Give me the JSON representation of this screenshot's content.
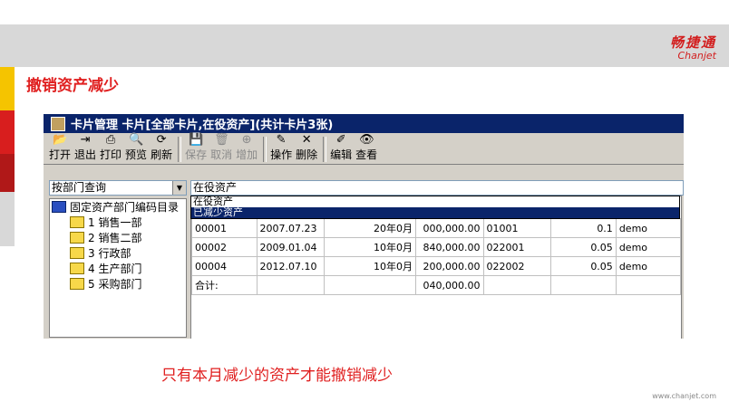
{
  "brand": {
    "logo_cn": "畅捷通",
    "logo_en": "Chanjet"
  },
  "slide": {
    "title": "撤销资产减少",
    "caption": "只有本月减少的资产才能撤销减少",
    "footer_url": "www.chanjet.com"
  },
  "colors": {
    "accent": "#e02020",
    "titlebar": "#0a246a",
    "strip_yellow": "#f5c400",
    "strip_red": "#d81e1e",
    "strip_dark": "#b01818"
  },
  "window": {
    "title": "卡片管理  卡片[全部卡片,在役资产](共计卡片3张)",
    "toolbar": [
      {
        "label": "打开",
        "icon": "open-folder-icon",
        "glyph": "📂",
        "disabled": false
      },
      {
        "label": "退出",
        "icon": "exit-icon",
        "glyph": "⇥",
        "disabled": false
      },
      {
        "label": "打印",
        "icon": "printer-icon",
        "glyph": "⎙",
        "disabled": false
      },
      {
        "label": "预览",
        "icon": "preview-icon",
        "glyph": "🔍",
        "disabled": false
      },
      {
        "label": "刷新",
        "icon": "refresh-icon",
        "glyph": "⟳",
        "disabled": false
      },
      {
        "label": "保存",
        "icon": "save-icon",
        "glyph": "💾",
        "disabled": true
      },
      {
        "label": "取消",
        "icon": "cancel-icon",
        "glyph": "🗑",
        "disabled": true
      },
      {
        "label": "增加",
        "icon": "add-icon",
        "glyph": "⊕",
        "disabled": true
      },
      {
        "label": "操作",
        "icon": "edit-pen-icon",
        "glyph": "✎",
        "disabled": false
      },
      {
        "label": "删除",
        "icon": "delete-x-icon",
        "glyph": "✕",
        "disabled": false
      },
      {
        "label": "编辑",
        "icon": "edit-icon",
        "glyph": "✐",
        "disabled": false
      },
      {
        "label": "查看",
        "icon": "view-icon",
        "glyph": "👁",
        "disabled": false
      }
    ],
    "dept_query": "按部门查询",
    "tree": {
      "root": "固定资产部门编码目录",
      "items": [
        "1 销售一部",
        "2 销售二部",
        "3 行政部",
        "4 生产部门",
        "5 采购部门"
      ]
    },
    "filter": {
      "value": "在役资产",
      "options": [
        "在役资产",
        "已减少资产"
      ],
      "selected_index": 1
    },
    "table": {
      "rows": [
        [
          "00001",
          "2007.07.23",
          "20年0月",
          "000,000.00",
          "01001",
          "0.1",
          "demo"
        ],
        [
          "00002",
          "2009.01.04",
          "10年0月",
          "840,000.00",
          "022001",
          "0.05",
          "demo"
        ],
        [
          "00004",
          "2012.07.10",
          "10年0月",
          "200,000.00",
          "022002",
          "0.05",
          "demo"
        ],
        [
          "合计:",
          "",
          "",
          "040,000.00",
          "",
          "",
          ""
        ]
      ]
    }
  }
}
